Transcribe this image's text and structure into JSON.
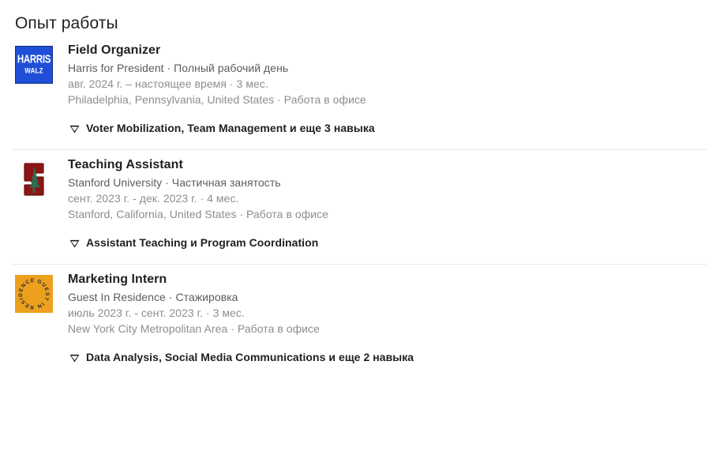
{
  "section": {
    "title": "Опыт работы"
  },
  "colors": {
    "harris_blue": "#1f4ed8",
    "stanford_red": "#8c1515",
    "stanford_tree_green": "#2e6b52",
    "gir_orange": "#eda01e",
    "title_text": "#1f1f1f",
    "secondary_text": "#5c5c5c",
    "tertiary_text": "#8d8d8d",
    "divider": "#e8e8e8"
  },
  "entries": [
    {
      "logo": "harris-walz-logo",
      "logo_line1": "HARRIS",
      "logo_line2": "WALZ",
      "title": "Field Organizer",
      "company_line": "Harris for President · Полный рабочий день",
      "date_line": "авг. 2024 г. – настоящее время · 3 мес.",
      "location_line": "Philadelphia, Pennsylvania, United States · Работа в офисе",
      "skills_icon": "skill-badge-icon",
      "skills_text": "Voter Mobilization, Team Management и еще 3 навыка"
    },
    {
      "logo": "stanford-university-logo",
      "title": "Teaching Assistant",
      "company_line": "Stanford University · Частичная занятость",
      "date_line": "сент. 2023 г. - дек. 2023 г. · 4 мес.",
      "location_line": "Stanford, California, United States · Работа в офисе",
      "skills_icon": "skill-badge-icon",
      "skills_text": "Assistant Teaching и Program Coordination"
    },
    {
      "logo": "guest-in-residence-logo",
      "logo_text": "GUEST IN RESIDENCE",
      "title": "Marketing Intern",
      "company_line": "Guest In Residence · Стажировка",
      "date_line": "июль 2023 г. - сент. 2023 г. · 3 мес.",
      "location_line": "New York City Metropolitan Area · Работа в офисе",
      "skills_icon": "skill-badge-icon",
      "skills_text": "Data Analysis, Social Media Communications и еще 2 навыка"
    }
  ]
}
